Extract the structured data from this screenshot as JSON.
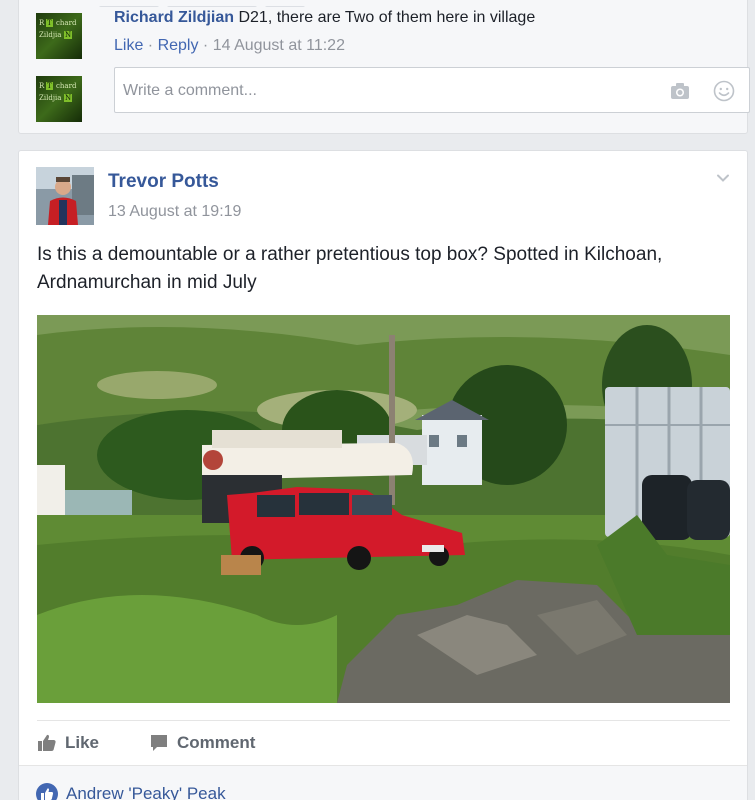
{
  "top_comment": {
    "author": "Richard Zildjian",
    "text": "D21, there are Two of them here in village",
    "like_label": "Like",
    "reply_label": "Reply",
    "separator": " · ",
    "timestamp": "14 August at 11:22",
    "avatar_text_1": "R",
    "avatar_text_2": "T",
    "avatar_text_3": "chard",
    "avatar_text_4": "Zildjia",
    "avatar_text_5": "N"
  },
  "comment_input": {
    "placeholder": "Write a comment..."
  },
  "post": {
    "author": "Trevor Potts",
    "timestamp": "13 August at 19:19",
    "text": "Is this a demountable or a rather pretentious top box? Spotted in Kilchoan, Ardnamurchan in mid July",
    "like_label": "Like",
    "comment_label": "Comment"
  },
  "reactions": {
    "first_name": "Andrew 'Peaky' Peak"
  },
  "colors": {
    "link_blue": "#365899",
    "action_grey": "#606770",
    "meta_grey": "#90949c",
    "background": "#e9ebee"
  }
}
